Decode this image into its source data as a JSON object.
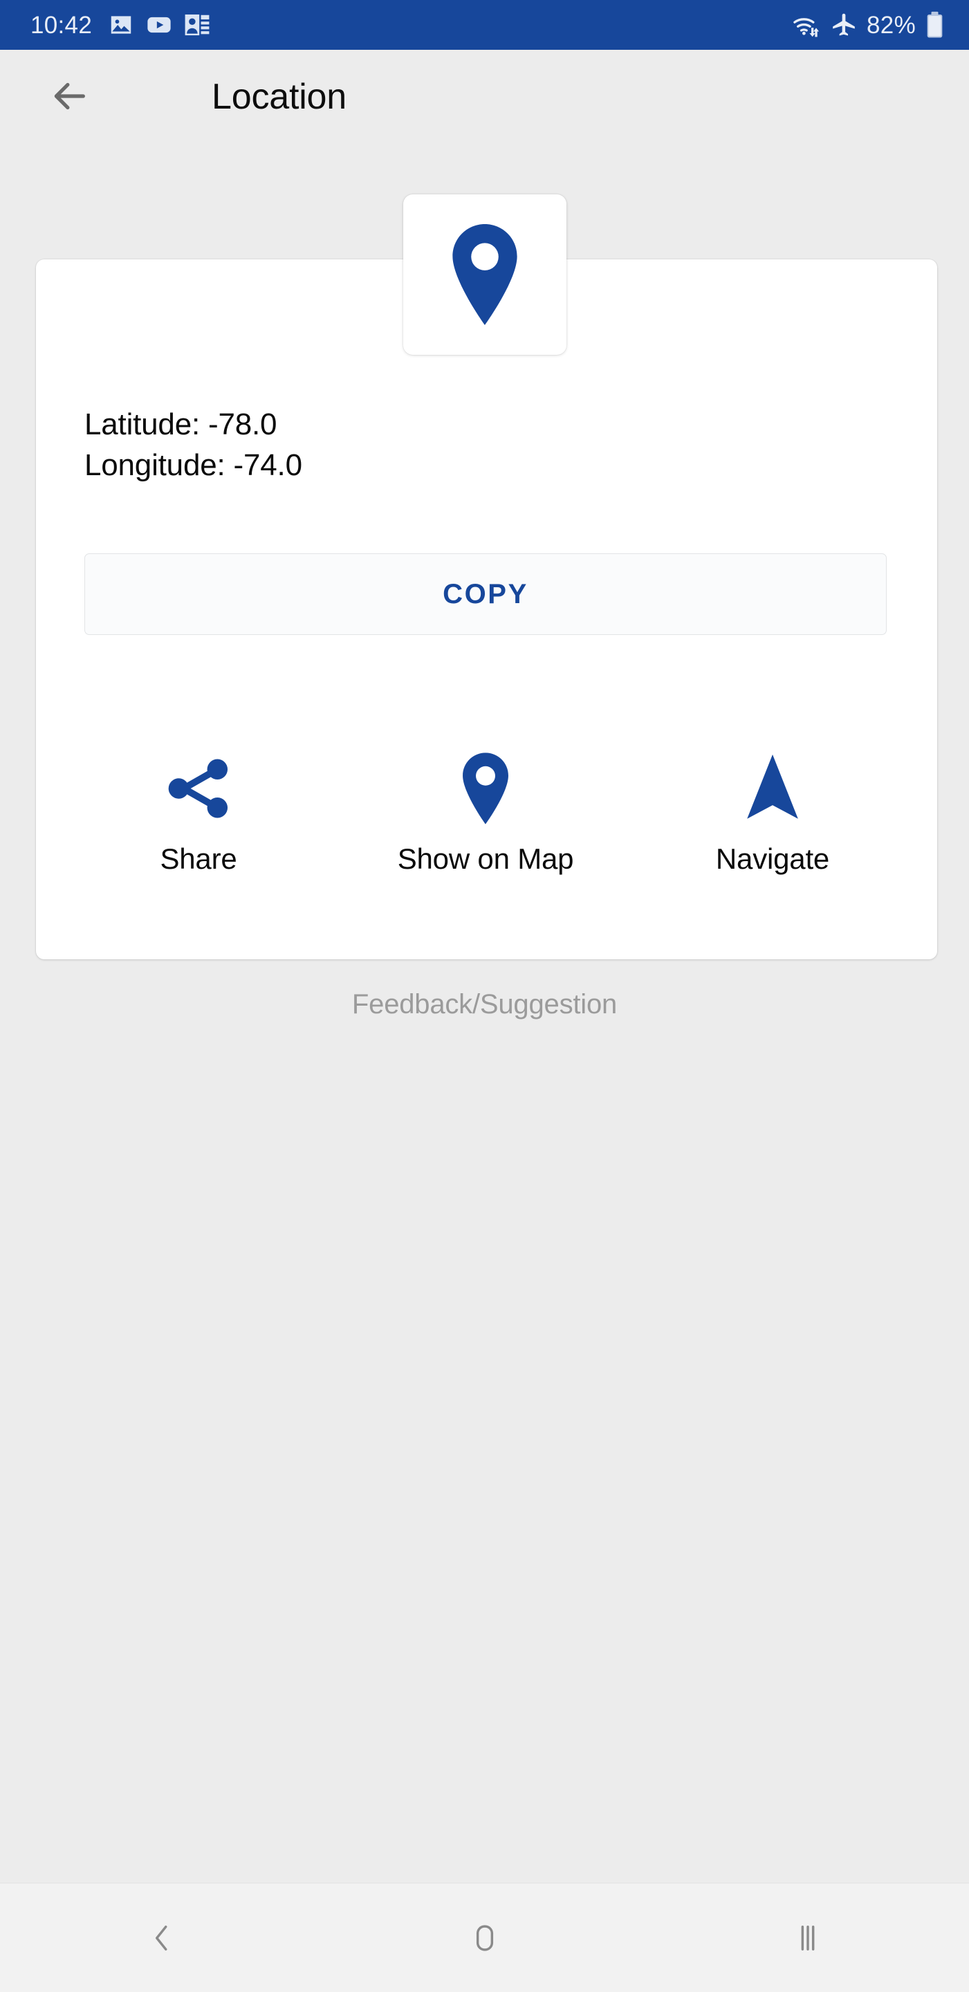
{
  "statusbar": {
    "time": "10:42",
    "battery_percent": "82%",
    "left_icons": [
      "image-icon",
      "video-play-icon",
      "contacts-icon"
    ],
    "right_icons": [
      "wifi-icon",
      "airplane-mode-icon",
      "battery-icon"
    ],
    "background_color": "#17479b",
    "foreground_color": "#e9eef7"
  },
  "appbar": {
    "back_icon": "back-arrow-icon",
    "title": "Location"
  },
  "card": {
    "pin_icon": "map-pin-icon",
    "latitude_line": "Latitude: -78.0",
    "longitude_line": "Longitude: -74.0",
    "copy_label": "COPY",
    "actions": [
      {
        "icon": "share-icon",
        "label": "Share"
      },
      {
        "icon": "map-pin-icon",
        "label": "Show on Map"
      },
      {
        "icon": "navigate-arrow-icon",
        "label": "Navigate"
      }
    ]
  },
  "feedback": {
    "label": "Feedback/Suggestion"
  },
  "navbar": {
    "back_icon": "nav-back-icon",
    "home_icon": "nav-home-icon",
    "recents_icon": "nav-recents-icon"
  },
  "colors": {
    "accent_blue": "#17479b",
    "page_background": "#ececec",
    "card_background": "#ffffff",
    "muted_text": "#9b9b9b"
  }
}
